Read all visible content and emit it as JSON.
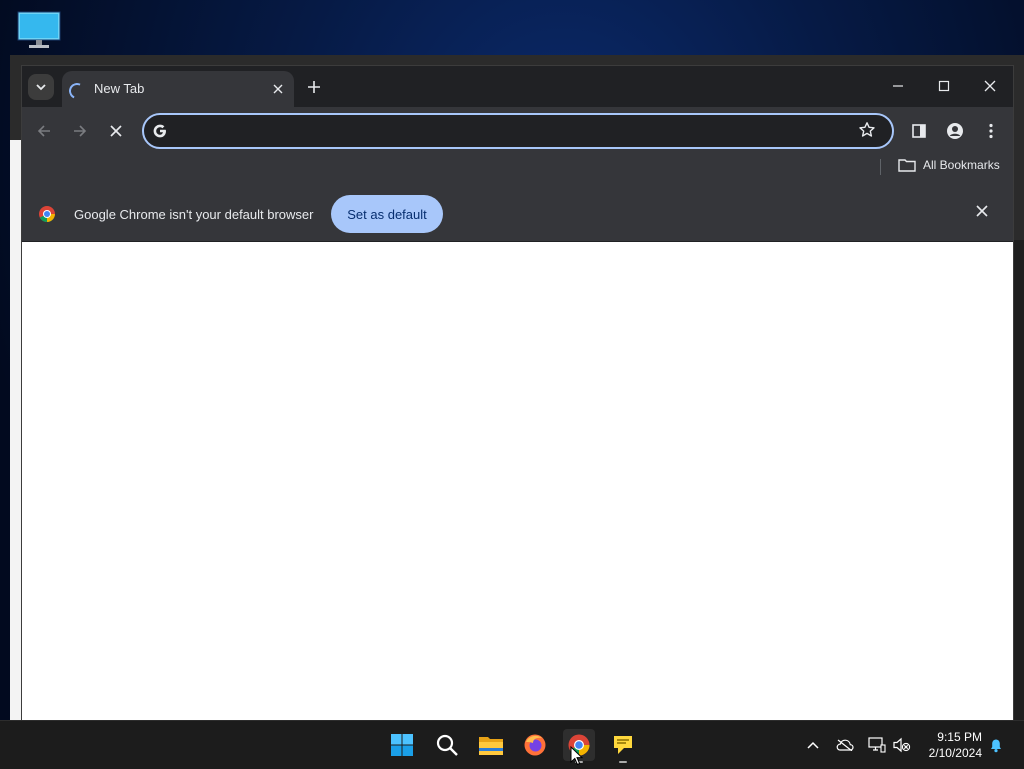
{
  "browser": {
    "tab_title": "New Tab",
    "omnibox_value": "",
    "bookmarks_bar": {
      "all_bookmarks_label": "All Bookmarks"
    },
    "infobar": {
      "message": "Google Chrome isn't your default browser",
      "button_label": "Set as default"
    }
  },
  "taskbar": {
    "pinned_apps": [
      "start",
      "search",
      "file-explorer",
      "firefox",
      "chrome",
      "notes"
    ],
    "active_app": "chrome",
    "clock": {
      "time": "9:15 PM",
      "date": "2/10/2024"
    }
  },
  "colors": {
    "accent_blue": "#a8c7fa",
    "toolbar": "#35363a",
    "tabstrip": "#202124"
  }
}
